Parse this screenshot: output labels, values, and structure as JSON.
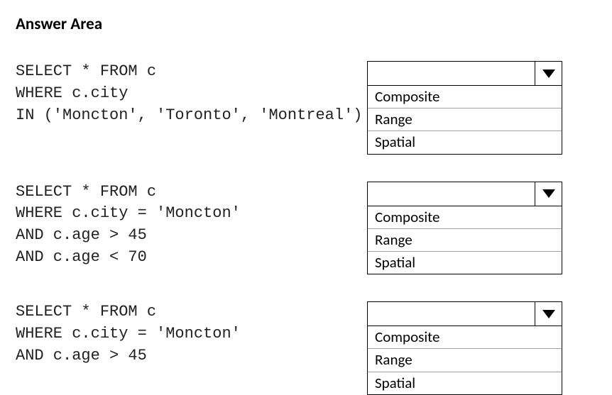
{
  "title": "Answer Area",
  "rows": [
    {
      "query": "SELECT * FROM c\nWHERE c.city\nIN ('Moncton', 'Toronto', 'Montreal')",
      "dropdown": {
        "selected": "",
        "options": [
          "Composite",
          "Range",
          "Spatial"
        ]
      }
    },
    {
      "query": "SELECT * FROM c\nWHERE c.city = 'Moncton'\nAND c.age > 45\nAND c.age < 70",
      "dropdown": {
        "selected": "",
        "options": [
          "Composite",
          "Range",
          "Spatial"
        ]
      }
    },
    {
      "query": "SELECT * FROM c\nWHERE c.city = 'Moncton'\nAND c.age > 45",
      "dropdown": {
        "selected": "",
        "options": [
          "Composite",
          "Range",
          "Spatial"
        ]
      }
    }
  ]
}
